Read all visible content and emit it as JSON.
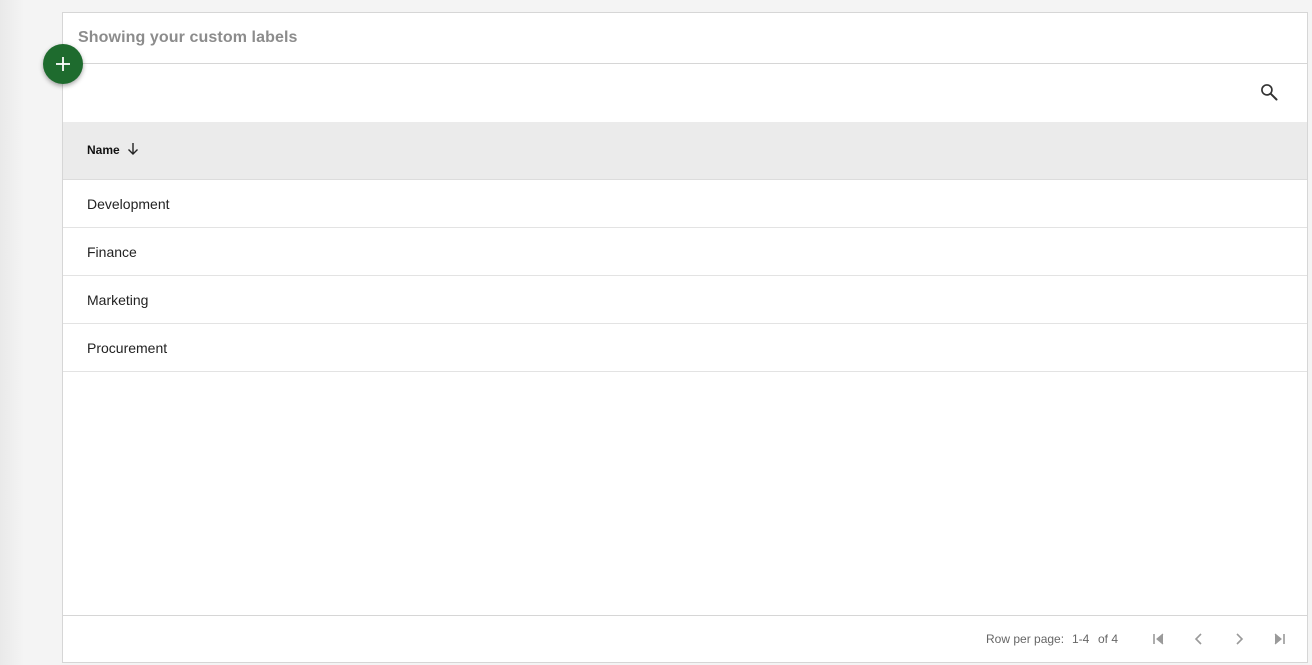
{
  "panel": {
    "title": "Showing your custom labels"
  },
  "icons": {
    "fab": "plus-icon",
    "search": "search-icon",
    "sort": "arrow-down-icon",
    "first": "first-page-icon",
    "prev": "chevron-left-icon",
    "next": "chevron-right-icon",
    "last": "last-page-icon"
  },
  "colors": {
    "fab": "#1e6b2e",
    "header_bg": "#ebebeb",
    "title": "#8c8c8c"
  },
  "table": {
    "columns": [
      {
        "label": "Name",
        "sort": "descending"
      }
    ],
    "rows": [
      {
        "name": "Development"
      },
      {
        "name": "Finance"
      },
      {
        "name": "Marketing"
      },
      {
        "name": "Procurement"
      }
    ]
  },
  "pagination": {
    "rows_per_page_label": "Row per page:",
    "range": "1-4",
    "of_total": "of 4"
  }
}
